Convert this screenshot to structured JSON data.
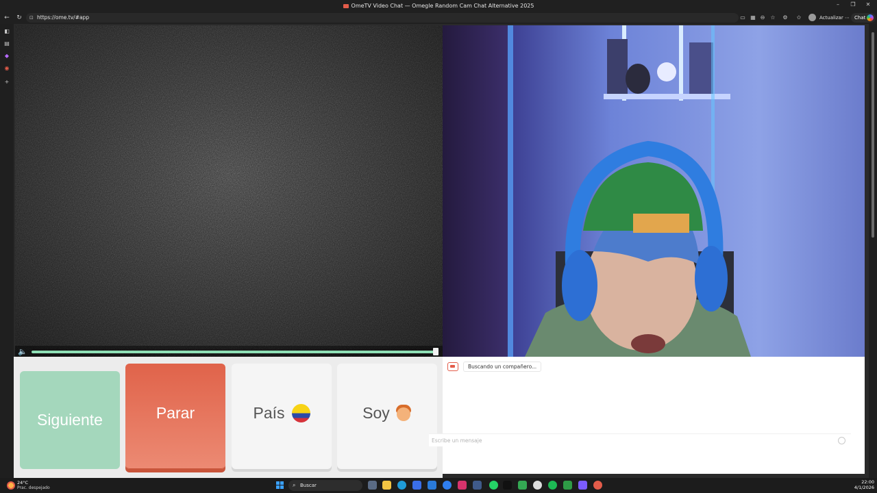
{
  "window": {
    "title": "OmeTV Video Chat — Omegle Random Cam Chat Alternative 2025"
  },
  "address_bar": {
    "url": "https://ome.tv/#app",
    "update_label": "Actualizar",
    "chat_label": "Chat"
  },
  "remote_video": {
    "volume_level": 1.0
  },
  "controls": {
    "next_label": "Siguiente",
    "stop_label": "Parar",
    "country_label": "País",
    "gender_label": "Soy"
  },
  "chat": {
    "status_message": "Buscando un compañero...",
    "input_placeholder": "Escribe un mensaje"
  },
  "taskbar": {
    "weather_temp": "24°C",
    "weather_condition": "Prac. despejado",
    "search_label": "Buscar",
    "time": "22:00",
    "date": "4/1/2026"
  },
  "colors": {
    "next_button": "#a4d7bc",
    "stop_button": "#e66e53",
    "volume_track": "#8fe0b6"
  }
}
